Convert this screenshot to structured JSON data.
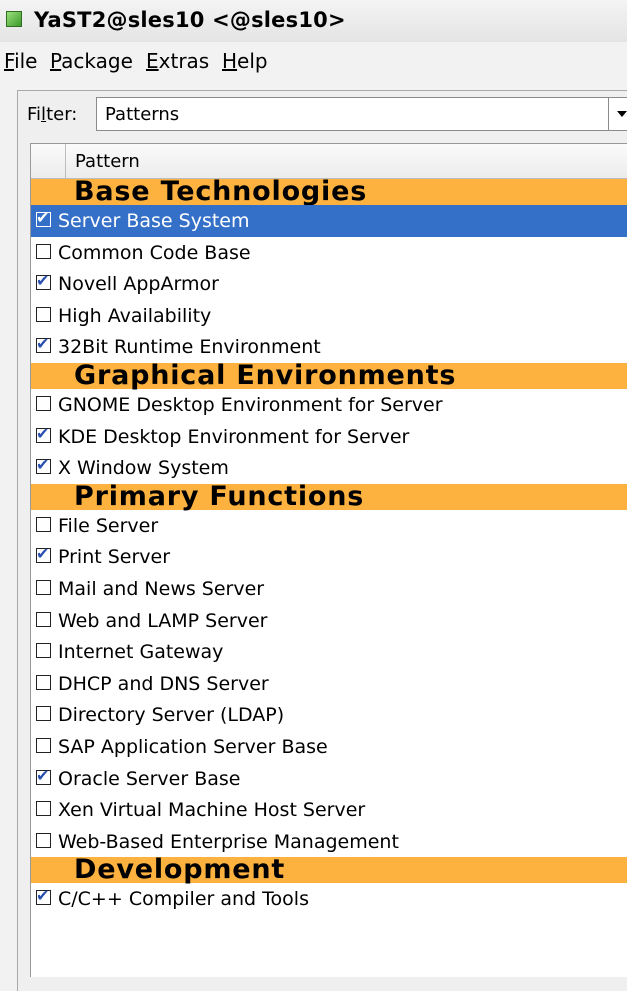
{
  "window": {
    "title": "YaST2@sles10 <@sles10>",
    "icon": "yast-app-icon"
  },
  "menu": [
    {
      "mnemonic": "F",
      "rest": "ile"
    },
    {
      "mnemonic": "P",
      "rest": "ackage"
    },
    {
      "mnemonic": "E",
      "rest": "xtras"
    },
    {
      "mnemonic": "H",
      "rest": "elp"
    }
  ],
  "filter": {
    "label_pre": "Fi",
    "label_mn": "l",
    "label_post": "ter:",
    "value": "Patterns"
  },
  "table": {
    "header": "Pattern",
    "rows": [
      {
        "type": "category",
        "label": "Base Technologies"
      },
      {
        "type": "item",
        "label": "Server Base System",
        "checked": true,
        "selected": true
      },
      {
        "type": "item",
        "label": "Common Code Base",
        "checked": false
      },
      {
        "type": "item",
        "label": "Novell AppArmor",
        "checked": true
      },
      {
        "type": "item",
        "label": "High Availability",
        "checked": false
      },
      {
        "type": "item",
        "label": "32Bit Runtime Environment",
        "checked": true
      },
      {
        "type": "category",
        "label": "Graphical Environments"
      },
      {
        "type": "item",
        "label": "GNOME Desktop Environment for Server",
        "checked": false
      },
      {
        "type": "item",
        "label": "KDE Desktop Environment for Server",
        "checked": true
      },
      {
        "type": "item",
        "label": "X Window System",
        "checked": true
      },
      {
        "type": "category",
        "label": "Primary Functions"
      },
      {
        "type": "item",
        "label": "File Server",
        "checked": false
      },
      {
        "type": "item",
        "label": "Print Server",
        "checked": true
      },
      {
        "type": "item",
        "label": "Mail and News Server",
        "checked": false
      },
      {
        "type": "item",
        "label": "Web and LAMP Server",
        "checked": false
      },
      {
        "type": "item",
        "label": "Internet Gateway",
        "checked": false
      },
      {
        "type": "item",
        "label": "DHCP and DNS Server",
        "checked": false
      },
      {
        "type": "item",
        "label": "Directory Server (LDAP)",
        "checked": false
      },
      {
        "type": "item",
        "label": "SAP Application Server Base",
        "checked": false
      },
      {
        "type": "item",
        "label": "Oracle Server Base",
        "checked": true
      },
      {
        "type": "item",
        "label": "Xen Virtual Machine Host Server",
        "checked": false
      },
      {
        "type": "item",
        "label": "Web-Based Enterprise Management",
        "checked": false
      },
      {
        "type": "category",
        "label": "Development"
      },
      {
        "type": "item",
        "label": "C/C++ Compiler and Tools",
        "checked": true
      }
    ]
  },
  "colors": {
    "category_bg": "#fdb23f",
    "selection_bg": "#3470c8",
    "check_mark": "#2a50b0"
  }
}
